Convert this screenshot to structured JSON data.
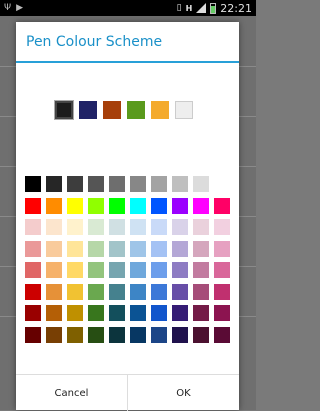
{
  "status": {
    "time": "22:21",
    "left_icons": [
      "usb-icon",
      "play-icon"
    ],
    "right_icons": [
      "vibrate-icon",
      "data-h-icon",
      "signal-icon",
      "battery-icon"
    ]
  },
  "dialog": {
    "title": "Pen Colour Scheme",
    "selected_colors": [
      "#1b1b1b",
      "#1f2266",
      "#a63f0a",
      "#5a9a1c",
      "#f4aa2c",
      "#eeeeee"
    ],
    "active_index": 0,
    "palette": [
      [
        "#000000",
        "#262626",
        "#3d3d3d",
        "#555555",
        "#6e6e6e",
        "#878787",
        "#a3a3a3",
        "#bfbfbf",
        "#dcdcdc",
        "#ffffff"
      ],
      [
        "#ff0000",
        "#ff8c00",
        "#ffff00",
        "#90ff00",
        "#00ff00",
        "#00ffff",
        "#0055ff",
        "#9b00ff",
        "#ff00ff",
        "#ff0066"
      ],
      [
        "#f4cccc",
        "#fce5cd",
        "#fff2cc",
        "#d9ead3",
        "#d0e0e3",
        "#cfe2f3",
        "#c9daf8",
        "#d9d2e9",
        "#ead1dc",
        "#f2d0e0"
      ],
      [
        "#ea9999",
        "#f9cb9c",
        "#ffe599",
        "#b6d7a8",
        "#a2c4c9",
        "#9fc5e8",
        "#a4c2f4",
        "#b4a7d6",
        "#d5a6bd",
        "#e6a1c1"
      ],
      [
        "#e06666",
        "#f6b26b",
        "#ffd966",
        "#93c47d",
        "#76a5af",
        "#6fa8dc",
        "#6d9eeb",
        "#8e7cc3",
        "#c27ba0",
        "#d9679a"
      ],
      [
        "#cc0000",
        "#e69138",
        "#f1c232",
        "#6aa84f",
        "#45818e",
        "#3d85c6",
        "#3c78d8",
        "#674ea7",
        "#a64d79",
        "#c0306f"
      ],
      [
        "#990000",
        "#b45f06",
        "#bf9000",
        "#38761d",
        "#134f5c",
        "#0b5394",
        "#1155cc",
        "#351c75",
        "#741b47",
        "#8c1450"
      ],
      [
        "#660000",
        "#783f04",
        "#7f6000",
        "#274e13",
        "#0c343d",
        "#073763",
        "#1c4587",
        "#20124d",
        "#4c1130",
        "#5a0b35"
      ]
    ],
    "cancel_label": "Cancel",
    "ok_label": "OK"
  }
}
